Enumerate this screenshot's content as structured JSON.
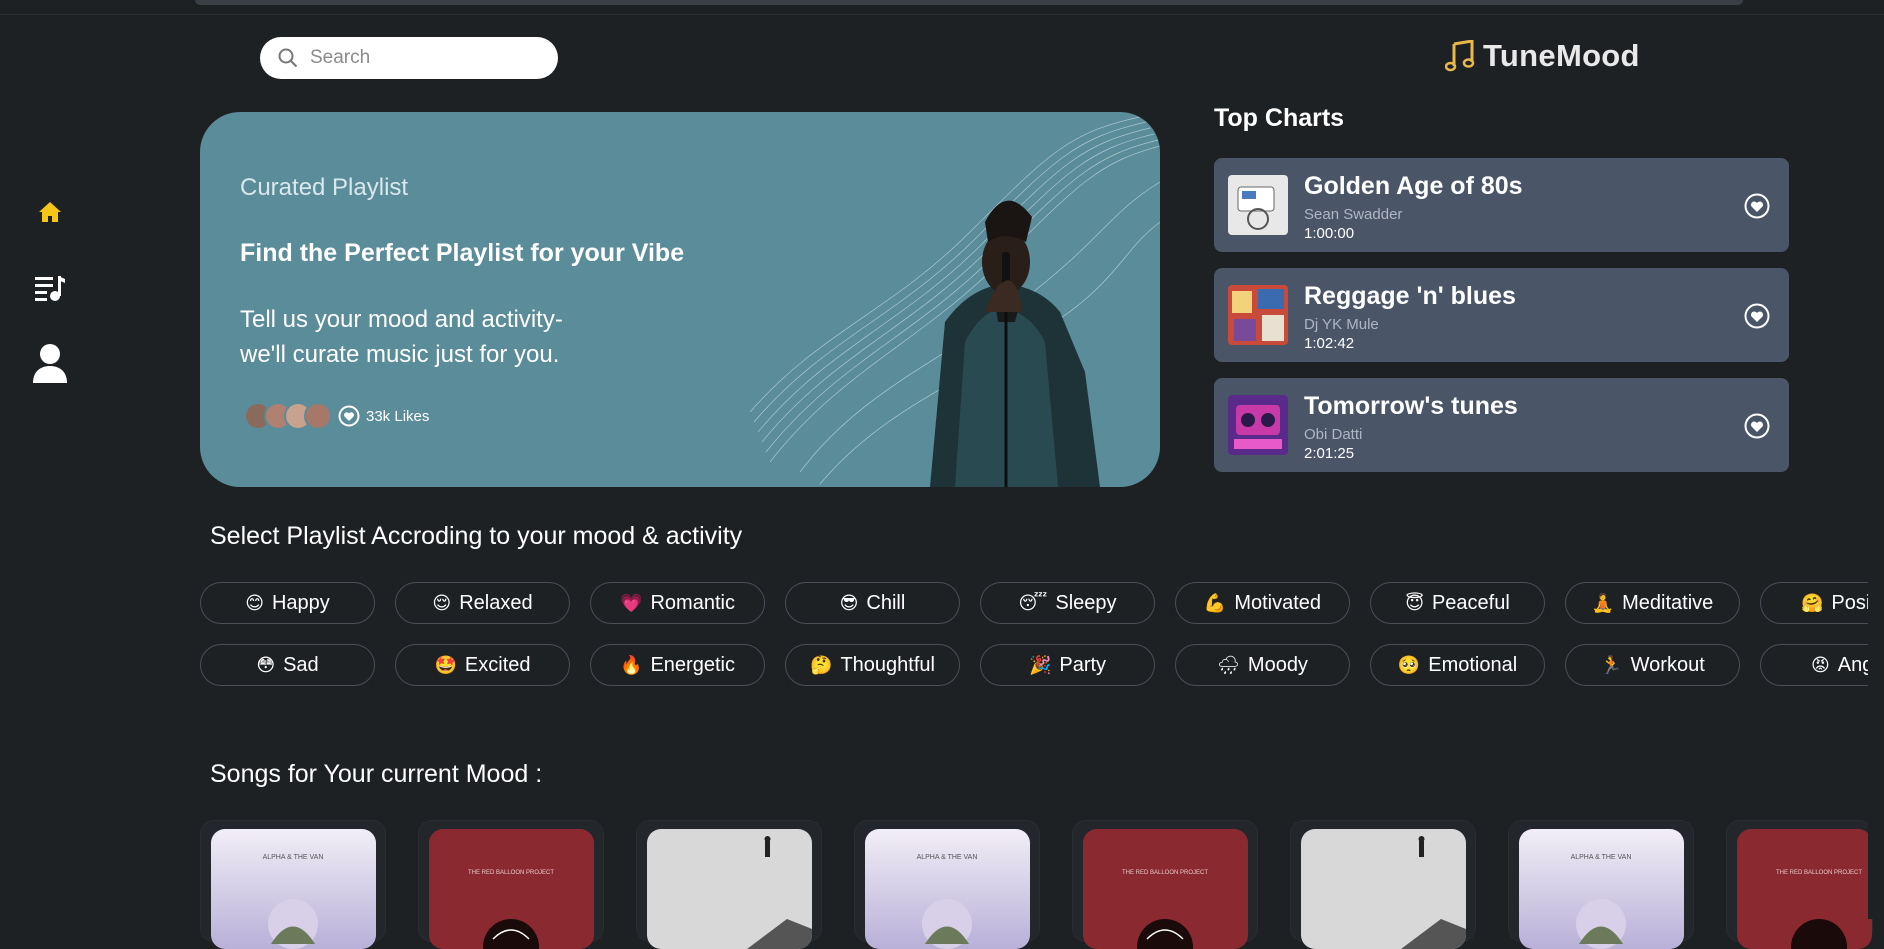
{
  "app": {
    "name": "TuneMood"
  },
  "search": {
    "placeholder": "Search"
  },
  "sidebar": {
    "items": [
      "home-icon",
      "playlist-icon",
      "profile-icon"
    ],
    "active_color": "#f5c518"
  },
  "hero": {
    "eyebrow": "Curated Playlist",
    "title": "Find the Perfect Playlist for your Vibe",
    "description_line1": "Tell us your mood and activity-",
    "description_line2": "we'll curate music just for you.",
    "likes": "33k Likes",
    "background": "#5a8c9a"
  },
  "top_charts": {
    "title": "Top Charts",
    "items": [
      {
        "name": "Golden Age of 80s",
        "artist": "Sean Swadder",
        "duration": "1:00:00"
      },
      {
        "name": "Reggage 'n' blues",
        "artist": "Dj YK Mule",
        "duration": "1:02:42"
      },
      {
        "name": "Tomorrow's tunes",
        "artist": "Obi Datti",
        "duration": "2:01:25"
      }
    ]
  },
  "moods": {
    "title": "Select Playlist Accroding to your mood & activity",
    "row1": [
      {
        "emoji": "😊",
        "label": "Happy"
      },
      {
        "emoji": "😌",
        "label": "Relaxed"
      },
      {
        "emoji": "💗",
        "label": "Romantic"
      },
      {
        "emoji": "😎",
        "label": "Chill"
      },
      {
        "emoji": "😴",
        "label": "Sleepy"
      },
      {
        "emoji": "💪",
        "label": "Motivated"
      },
      {
        "emoji": "😇",
        "label": "Peaceful"
      },
      {
        "emoji": "🧘",
        "label": "Meditative"
      },
      {
        "emoji": "🤗",
        "label": "Posit"
      }
    ],
    "row2": [
      {
        "emoji": "😳",
        "label": "Sad"
      },
      {
        "emoji": "🤩",
        "label": "Excited"
      },
      {
        "emoji": "🔥",
        "label": "Energetic"
      },
      {
        "emoji": "🤔",
        "label": "Thoughtful"
      },
      {
        "emoji": "🎉",
        "label": "Party"
      },
      {
        "emoji": "🌧",
        "label": "Moody"
      },
      {
        "emoji": "🥺",
        "label": "Emotional"
      },
      {
        "emoji": "🏃",
        "label": "Workout"
      },
      {
        "emoji": "😡",
        "label": "Ang"
      }
    ]
  },
  "songs": {
    "title": "Songs for Your current Mood :",
    "covers": [
      "ALPHA & THE VAN",
      "THE RED BALLOON PROJECT",
      "",
      "ALPHA & THE VAN",
      "THE RED BALLOON PROJECT",
      "",
      "ALPHA & THE VAN",
      "THE RED BALLOON PROJECT"
    ]
  }
}
